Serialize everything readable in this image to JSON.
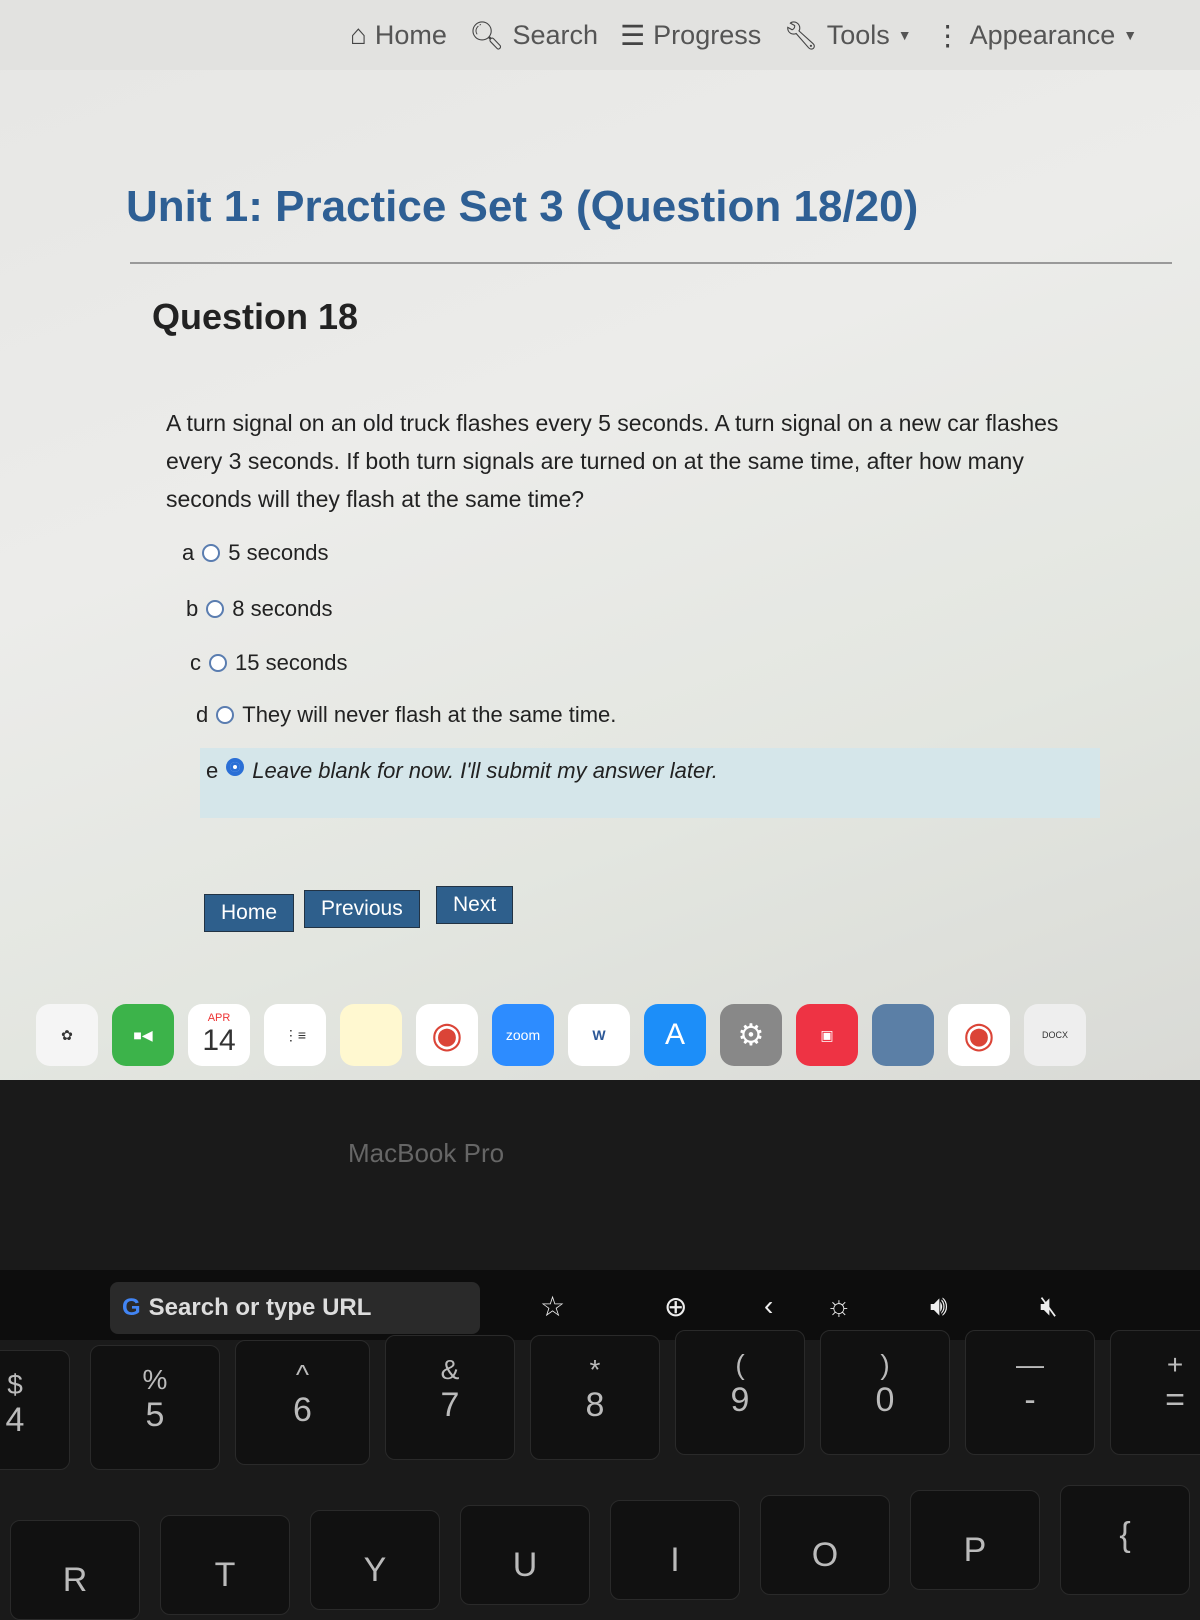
{
  "nav": {
    "items": [
      {
        "label": "Home",
        "icon": "home-icon"
      },
      {
        "label": "Search",
        "icon": "search-icon"
      },
      {
        "label": "Progress",
        "icon": "list-icon"
      },
      {
        "label": "Tools",
        "icon": "wrench-icon"
      },
      {
        "label": "Appearance",
        "icon": "kebab-icon"
      }
    ]
  },
  "page": {
    "title": "Unit 1: Practice Set 3 (Question 18/20)",
    "question_heading": "Question 18",
    "question_text": "A turn signal on an old truck flashes every 5 seconds. A turn signal on a new car flashes every 3 seconds. If both turn signals are turned on at the same time, after how many seconds will they flash at the same time?",
    "options": [
      {
        "letter": "a",
        "label": "5 seconds",
        "selected": false
      },
      {
        "letter": "b",
        "label": "8 seconds",
        "selected": false
      },
      {
        "letter": "c",
        "label": "15 seconds",
        "selected": false
      },
      {
        "letter": "d",
        "label": "They will never flash at the same time.",
        "selected": false
      },
      {
        "letter": "e",
        "label": "Leave blank for now. I'll submit my answer later.",
        "selected": true
      }
    ],
    "buttons": {
      "home": "Home",
      "previous": "Previous",
      "next": "Next"
    }
  },
  "dock": {
    "calendar_month": "APR",
    "calendar_day": "14",
    "zoom_label": "zoom",
    "word_label": "W",
    "docx_label": "DOCX"
  },
  "laptop": {
    "label": "MacBook Pro"
  },
  "touchbar": {
    "url_placeholder": "Search or type URL",
    "g": "G"
  },
  "keys": [
    {
      "top": "$",
      "bottom": "4"
    },
    {
      "top": "%",
      "bottom": "5"
    },
    {
      "top": "^",
      "bottom": "6"
    },
    {
      "top": "&",
      "bottom": "7"
    },
    {
      "top": "*",
      "bottom": "8"
    },
    {
      "top": "(",
      "bottom": "9"
    },
    {
      "top": ")",
      "bottom": "0"
    },
    {
      "top": "—",
      "bottom": "-"
    },
    {
      "top": "+",
      "bottom": "="
    }
  ],
  "letter_keys": [
    "R",
    "T",
    "Y",
    "U",
    "I",
    "O",
    "P",
    "{"
  ]
}
